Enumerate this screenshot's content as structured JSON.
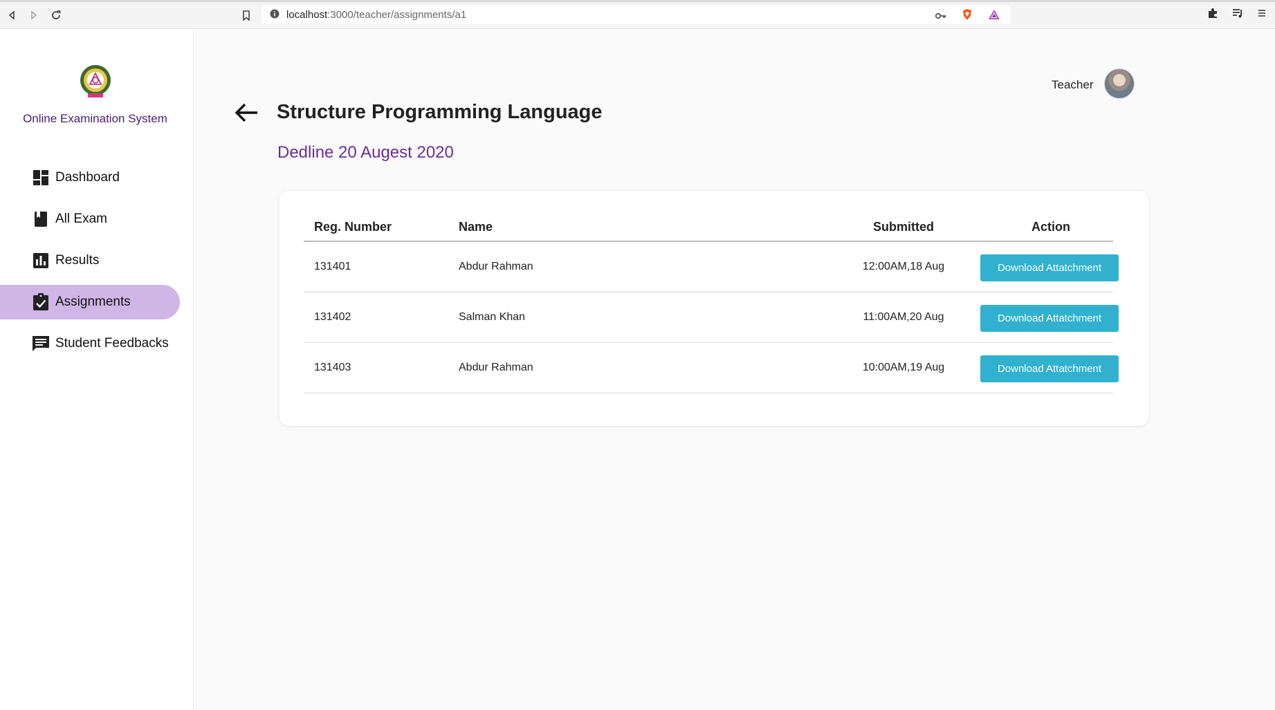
{
  "browser": {
    "url_host": "localhost",
    "url_path": ":3000/teacher/assignments/a1"
  },
  "sidebar": {
    "app_title": "Online Examination System",
    "items": [
      {
        "label": "Dashboard",
        "icon": "dashboard-icon",
        "active": false
      },
      {
        "label": "All Exam",
        "icon": "book-icon",
        "active": false
      },
      {
        "label": "Results",
        "icon": "bar-chart-icon",
        "active": false
      },
      {
        "label": "Assignments",
        "icon": "assignment-check-icon",
        "active": true
      },
      {
        "label": "Student Feedbacks",
        "icon": "feedback-icon",
        "active": false
      }
    ],
    "active_color": "#cfb6e6"
  },
  "header": {
    "user_role": "Teacher"
  },
  "main": {
    "title": "Structure Programming Language",
    "deadline": "Dedline 20 Augest 2020",
    "deadline_color": "#6c2c99",
    "table": {
      "columns": [
        "Reg. Number",
        "Name",
        "Submitted",
        "Action"
      ],
      "rows": [
        {
          "reg": "131401",
          "name": "Abdur Rahman",
          "submitted": "12:00AM,18 Aug",
          "action": "Download Attatchment"
        },
        {
          "reg": "131402",
          "name": "Salman Khan",
          "submitted": "11:00AM,20 Aug",
          "action": "Download Attatchment"
        },
        {
          "reg": "131403",
          "name": "Abdur Rahman",
          "submitted": "10:00AM,19 Aug",
          "action": "Download Attatchment"
        }
      ]
    },
    "button_color": "#31b1cf"
  }
}
